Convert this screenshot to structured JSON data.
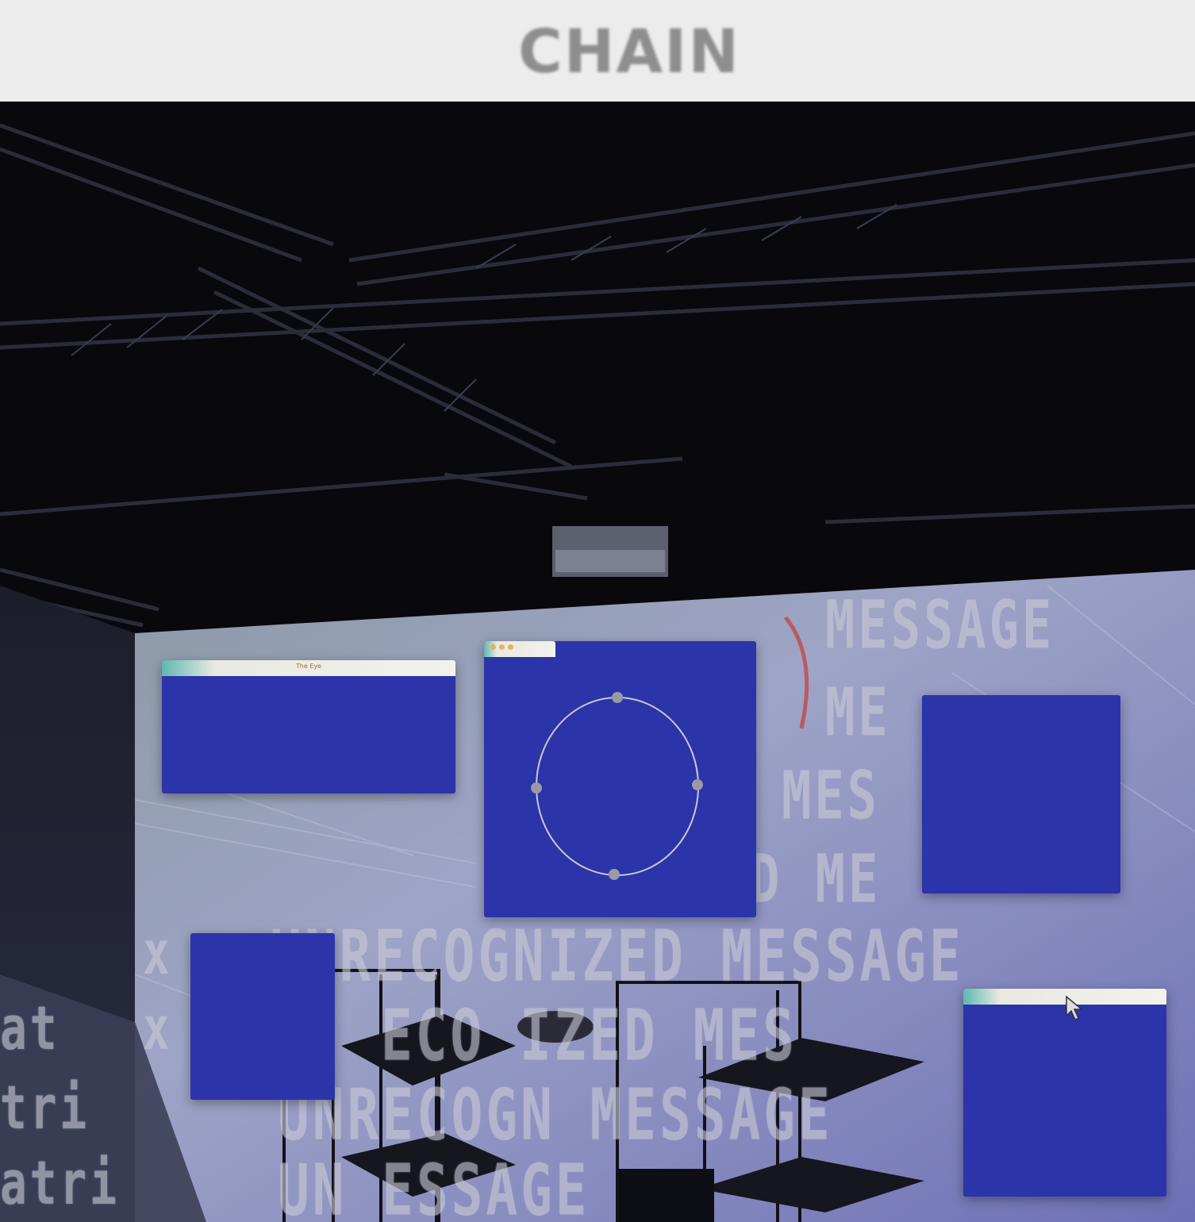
{
  "header": {
    "title": "CHAIN"
  },
  "projection": {
    "lines": [
      "MESSAGE",
      "ME",
      "MES",
      "D ME",
      "UNRECOGNIZED MESSAGE",
      "ECO IZED MES",
      "UNRECOGN MESSAGE",
      "UN ESSAGE"
    ],
    "left_fragments": [
      "x",
      "x",
      "at",
      "tri",
      "atri"
    ]
  },
  "windows": {
    "top_left": {
      "title": "The Eye"
    },
    "top_right": {
      "title": ""
    }
  },
  "colors": {
    "window_blue": "#2b34a8",
    "ceiling": "#08080d",
    "header_text": "#8e8e8e"
  }
}
